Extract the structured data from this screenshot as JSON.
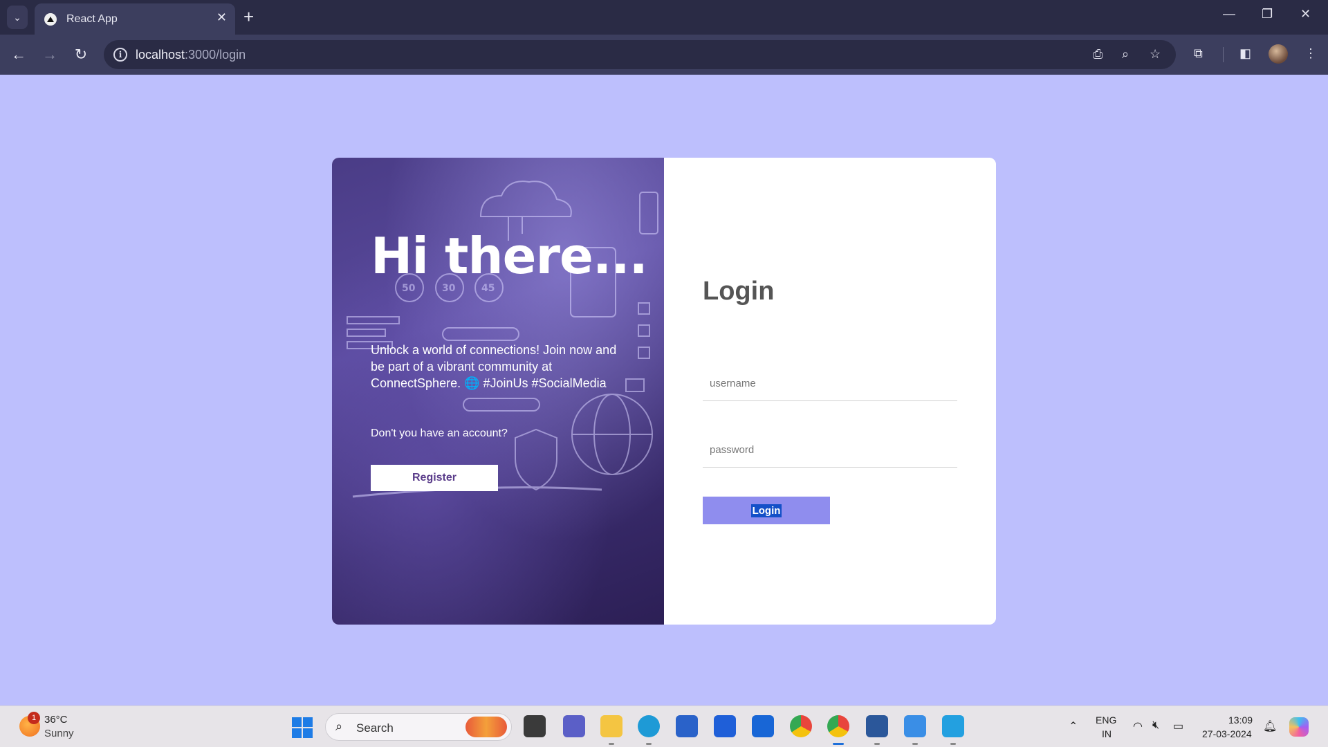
{
  "browser": {
    "tab_title": "React App",
    "url_host": "localhost",
    "url_path": ":3000/login"
  },
  "hero": {
    "title": "Hi there...",
    "text": "Unlock a world of connections! Join now and be part of a vibrant community at ConnectSphere. 🌐 #JoinUs #SocialMedia",
    "account_question": "Don't you have an account?",
    "register_label": "Register"
  },
  "login": {
    "title": "Login",
    "username_placeholder": "username",
    "password_placeholder": "password",
    "button_label": "Login"
  },
  "taskbar": {
    "weather_badge": "1",
    "temperature": "36°C",
    "condition": "Sunny",
    "search_label": "Search",
    "lang_line1": "ENG",
    "lang_line2": "IN",
    "time": "13:09",
    "date": "27-03-2024"
  },
  "colors": {
    "page_bg": "#bdbffd",
    "login_button": "#8f8dee",
    "register_text": "#5a3c8a"
  }
}
